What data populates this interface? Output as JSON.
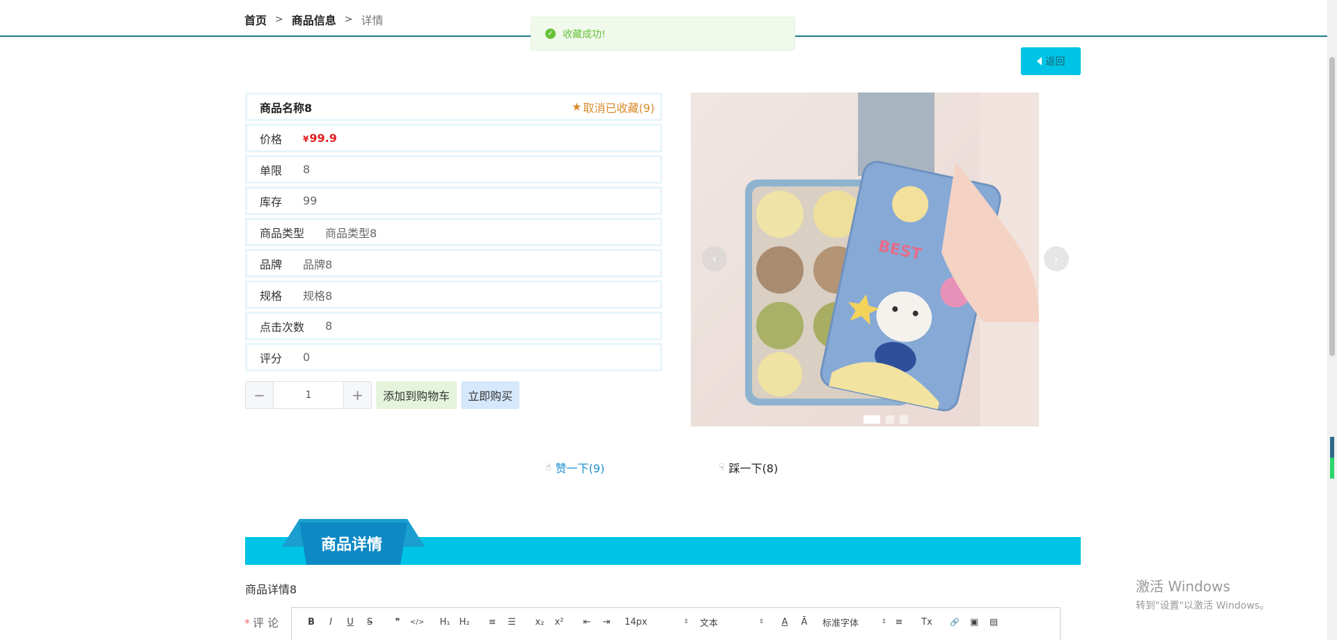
{
  "breadcrumb": {
    "home": "首页",
    "section": "商品信息",
    "current": "详情",
    "sep": ">"
  },
  "toast": {
    "message": "收藏成功!",
    "icon": "check-circle-icon"
  },
  "back_button": {
    "label": "返回"
  },
  "product": {
    "name": "商品名称8",
    "favorite_label": "取消已收藏(9)",
    "fields": [
      {
        "label": "价格",
        "currency": "¥",
        "value": "99.9"
      },
      {
        "label": "单限",
        "value": "8"
      },
      {
        "label": "库存",
        "value": "99"
      },
      {
        "label": "商品类型",
        "value": "商品类型8"
      },
      {
        "label": "品牌",
        "value": "品牌8"
      },
      {
        "label": "规格",
        "value": "规格8"
      },
      {
        "label": "点击次数",
        "value": "8"
      },
      {
        "label": "评分",
        "value": "0"
      }
    ]
  },
  "quantity": {
    "value": "1",
    "minus": "−",
    "plus": "+"
  },
  "buttons": {
    "add_to_cart": "添加到购物车",
    "buy_now": "立即购买"
  },
  "carousel": {
    "slide_count": 3,
    "active_index": 0,
    "prev": "‹",
    "next": "›",
    "image_text": "BEST"
  },
  "votes": {
    "like": "赞一下(9)",
    "dislike": "踩一下(8)"
  },
  "detail_section": {
    "title": "商品详情",
    "content": "商品详情8"
  },
  "comment": {
    "required_mark": "*",
    "label": "评 论",
    "toolbar": {
      "bold": "B",
      "italic": "I",
      "underline": "U",
      "strike": "S",
      "quote": "❞",
      "code": "</>",
      "h1": "H₁",
      "h2": "H₂",
      "ordered": "≡",
      "bullet": "☰",
      "sub": "x₂",
      "sup": "x²",
      "outdent": "⇤",
      "indent": "⇥",
      "size": "14px",
      "format": "文本",
      "color": "A",
      "background": "Ā",
      "font": "标准字体",
      "align": "≡",
      "clean": "Tx",
      "link": "🔗",
      "image": "▣",
      "video": "▤"
    }
  },
  "watermark": {
    "line1": "激活 Windows",
    "line2": "转到\"设置\"以激活 Windows。"
  },
  "colors": {
    "accent": "#00c4e5",
    "price": "#e02020",
    "favorite": "#d98a2a",
    "toast_green": "#67c23a"
  }
}
